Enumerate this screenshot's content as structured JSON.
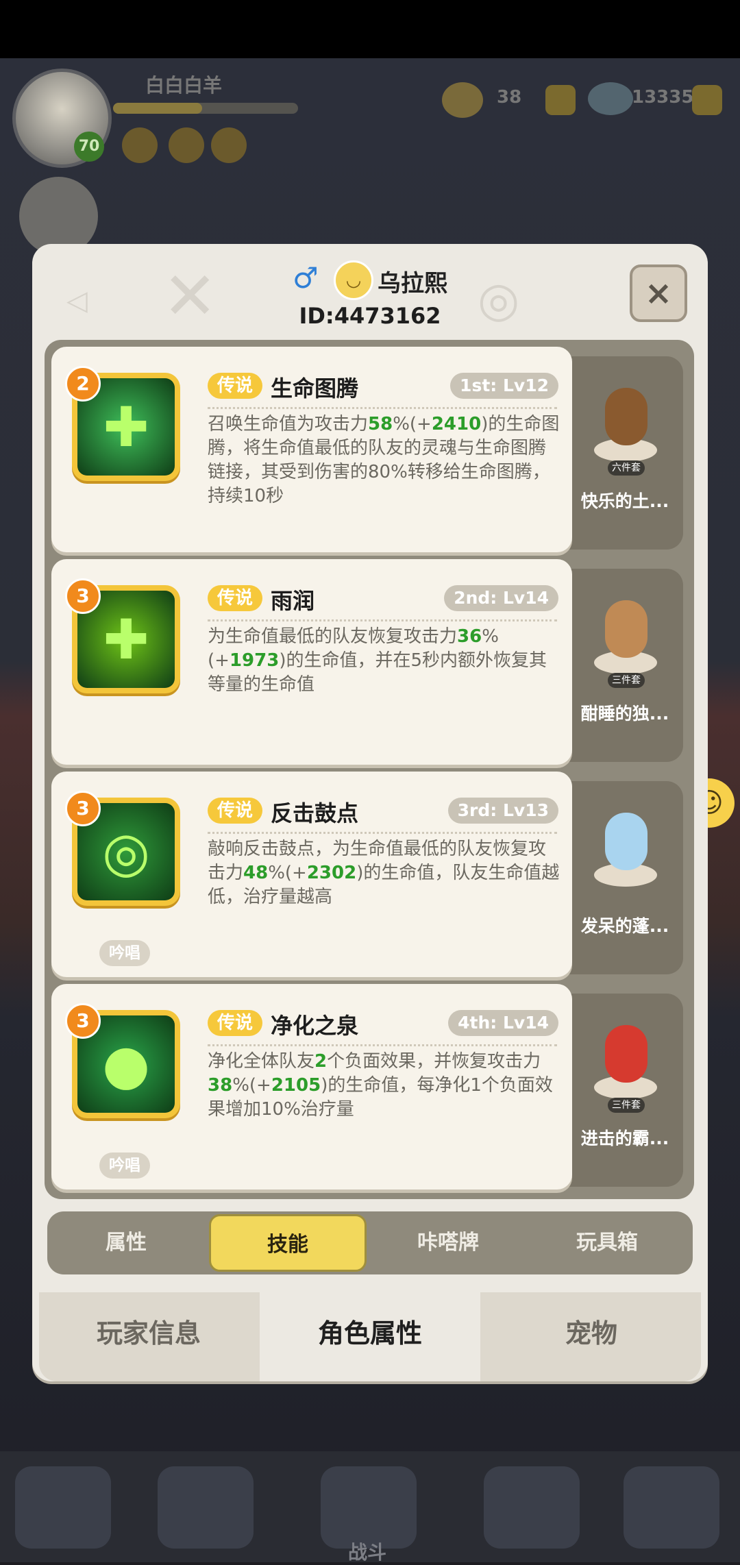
{
  "background": {
    "player_name": "白白白羊",
    "player_level": "70",
    "resource_1": "38",
    "resource_2": "13335",
    "battle_label": "战斗"
  },
  "chat": {
    "label": "聊天"
  },
  "panel": {
    "player_name": "乌拉熙",
    "player_id": "ID:4473162",
    "close_label": "×",
    "skills": [
      {
        "level_badge": "2",
        "tag": "传说",
        "name": "生命图腾",
        "slot_level": "1st: Lv12",
        "desc_parts": [
          "召唤生命值为攻击力",
          "58",
          "%(+",
          "2410",
          ")的生命图腾，将生命值最低的队友的灵魂与生命图腾链接，其受到伤害的80%转移给生命图腾，持续10秒"
        ],
        "chant": "",
        "pet_set": "六件套",
        "pet_name": "快乐的土...",
        "icon": "totem-icon",
        "icon_color": "#3fbf5a",
        "pet_color": "#8a5a2f"
      },
      {
        "level_badge": "3",
        "tag": "传说",
        "name": "雨润",
        "slot_level": "2nd: Lv14",
        "desc_parts": [
          "为生命值最低的队友恢复攻击力",
          "36",
          "%(+",
          "1973",
          ")的生命值，并在5秒内额外恢复其等量的生命值"
        ],
        "chant": "",
        "pet_set": "三件套",
        "pet_name": "酣睡的独...",
        "icon": "heal-cross-icon",
        "icon_color": "#6fc417",
        "pet_color": "#c08a55"
      },
      {
        "level_badge": "3",
        "tag": "传说",
        "name": "反击鼓点",
        "slot_level": "3rd: Lv13",
        "desc_parts": [
          "敲响反击鼓点，为生命值最低的队友恢复攻击力",
          "48",
          "%(+",
          "2302",
          ")的生命值，队友生命值越低，治疗量越高"
        ],
        "chant": "吟唱",
        "pet_set": "",
        "pet_name": "发呆的蓬...",
        "icon": "drum-icon",
        "icon_color": "#2f9a3a",
        "pet_color": "#a9d4ef"
      },
      {
        "level_badge": "3",
        "tag": "传说",
        "name": "净化之泉",
        "slot_level": "4th: Lv14",
        "desc_parts": [
          "净化全体队友",
          "2",
          "个负面效果，并恢复攻击力",
          "38",
          "%(+",
          "2105",
          ")的生命值，每净化1个负面效果增加10%治疗量"
        ],
        "chant": "吟唱",
        "pet_set": "三件套",
        "pet_name": "进击的霸...",
        "icon": "spring-drop-icon",
        "icon_color": "#2aa54a",
        "pet_color": "#d63a2f"
      }
    ],
    "tabs": [
      "属性",
      "技能",
      "咔嗒牌",
      "玩具箱"
    ],
    "active_tab": 1,
    "bottom_tabs": [
      "玩家信息",
      "角色属性",
      "宠物"
    ],
    "active_bottom_tab": 1
  }
}
